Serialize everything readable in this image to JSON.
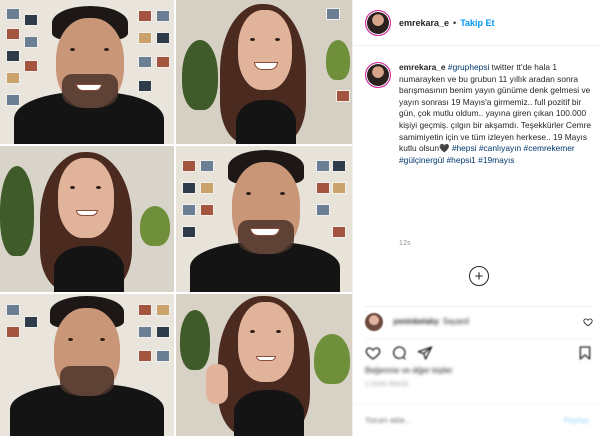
{
  "header": {
    "username": "emrekara_e",
    "separator": "•",
    "follow_label": "Takip Et"
  },
  "caption": {
    "username": "emrekara_e",
    "mention": "#gruphepsi",
    "text": " twitter tt'de hala 1 numarayken ve bu grubun 11 yıllık aradan sonra barışmasının benim yayın günüme denk gelmesi ve yayın sonrası 19 Mayıs'a girmemiz.. full pozitif bir gün, çok mutlu oldum.. yayına giren çıkan 100.000 kişiyi geçmiş. çılgın bir akşamdı. Teşekkürler Cemre samimiyetin için ve tüm izleyen herkese.. 19 Mayıs kutlu olsun",
    "heart": "🖤",
    "hashtags": [
      "#hepsi",
      "#canlıyayın",
      "#cemrekemer",
      "#gülçinergül",
      "#hepsi1",
      "#19mayıs"
    ]
  },
  "time_ago": "12s",
  "load_more_symbol": "+",
  "comment": {
    "username": "yeninbelalıy",
    "text": "Sayanil"
  },
  "likes_text": "Beğenme ve diğer kişiler",
  "days_text": "1 GÜN ÖNCE",
  "add_comment": {
    "placeholder": "Yorum ekle...",
    "post_label": "Paylaş"
  },
  "icons": {
    "heart": "heart-icon",
    "comment": "comment-icon",
    "share": "share-icon",
    "save": "bookmark-icon"
  },
  "colors": {
    "follow_blue": "#0095f6",
    "hashtag_blue": "#00376b",
    "muted_gray": "#8e8e8e",
    "border": "#efefef"
  }
}
